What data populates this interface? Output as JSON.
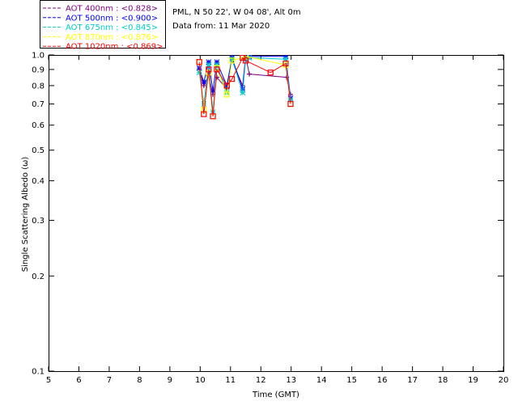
{
  "header": {
    "site_line": "PML, N 50 22', W 04 08', Alt 0m",
    "date_line": "Data from: 11 Mar 2020"
  },
  "legend_labels": [
    "AOT  400nm : <0.828>",
    "AOT  500nm : <0.900>",
    "AOT  675nm : <0.845>",
    "AOT  870nm : <0.876>",
    "AOT 1020nm : <0.869>"
  ],
  "chart_data": {
    "type": "scatter",
    "title": "",
    "xlabel": "Time (GMT)",
    "ylabel": "Single Scattering Albedo (ω)",
    "xlim": [
      5,
      20
    ],
    "ylim": [
      0.1,
      1.0
    ],
    "y_scale": "log",
    "grid": false,
    "legend_position": "top-left",
    "x_ticks": [
      5,
      6,
      7,
      8,
      9,
      10,
      11,
      12,
      13,
      14,
      15,
      16,
      17,
      18,
      19,
      20
    ],
    "y_ticks": [
      0.1,
      0.2,
      0.3,
      0.4,
      0.5,
      0.6,
      0.7,
      0.8,
      0.9,
      1.0
    ],
    "y_tick_labels": [
      "0.1",
      "0.2",
      "0.3",
      "0.4",
      "0.5",
      "0.6",
      "0.7",
      "0.8",
      "0.9",
      "1.0"
    ],
    "series": [
      {
        "name": "AOT  400nm : <0.828>",
        "color": "#800080",
        "marker": "plus",
        "x": [
          9.97,
          10.12,
          10.28,
          10.42,
          10.55,
          10.88,
          11.05,
          11.4,
          11.5,
          11.62,
          12.85,
          12.98
        ],
        "y": [
          0.9,
          0.8,
          0.86,
          0.75,
          0.85,
          0.78,
          0.96,
          0.8,
          0.99,
          0.87,
          0.85,
          0.75
        ]
      },
      {
        "name": "AOT  500nm : <0.900>",
        "color": "#0000ff",
        "marker": "asterisk",
        "x": [
          9.97,
          10.12,
          10.28,
          10.42,
          10.55,
          10.88,
          11.05,
          11.4,
          11.5,
          11.62,
          12.82,
          12.98
        ],
        "y": [
          0.91,
          0.82,
          0.95,
          0.77,
          0.95,
          0.8,
          0.98,
          0.78,
          0.98,
          0.99,
          0.99,
          0.73
        ]
      },
      {
        "name": "AOT  675nm : <0.845>",
        "color": "#00cccc",
        "marker": "asterisk",
        "x": [
          9.97,
          10.12,
          10.28,
          10.42,
          10.55,
          10.88,
          11.05,
          11.4,
          11.5,
          11.62,
          12.82,
          12.98
        ],
        "y": [
          0.88,
          0.7,
          0.93,
          0.66,
          0.93,
          0.76,
          0.97,
          0.76,
          0.97,
          0.98,
          0.97,
          0.72
        ]
      },
      {
        "name": "AOT  870nm : <0.876>",
        "color": "#ffff00",
        "marker": "square",
        "x": [
          9.97,
          10.12,
          10.28,
          10.42,
          10.55,
          10.88,
          11.05,
          11.4,
          11.5,
          12.82,
          12.98
        ],
        "y": [
          0.95,
          0.67,
          0.88,
          0.64,
          0.91,
          0.75,
          0.96,
          0.98,
          0.99,
          0.93,
          0.7
        ]
      },
      {
        "name": "AOT 1020nm : <0.869>",
        "color": "#ff0000",
        "marker": "square",
        "x": [
          9.97,
          10.12,
          10.28,
          10.42,
          10.55,
          10.88,
          11.05,
          11.4,
          11.5,
          12.32,
          12.82,
          12.98
        ],
        "y": [
          0.95,
          0.65,
          0.9,
          0.64,
          0.9,
          0.8,
          0.84,
          0.98,
          0.96,
          0.88,
          0.94,
          0.7
        ]
      }
    ]
  }
}
